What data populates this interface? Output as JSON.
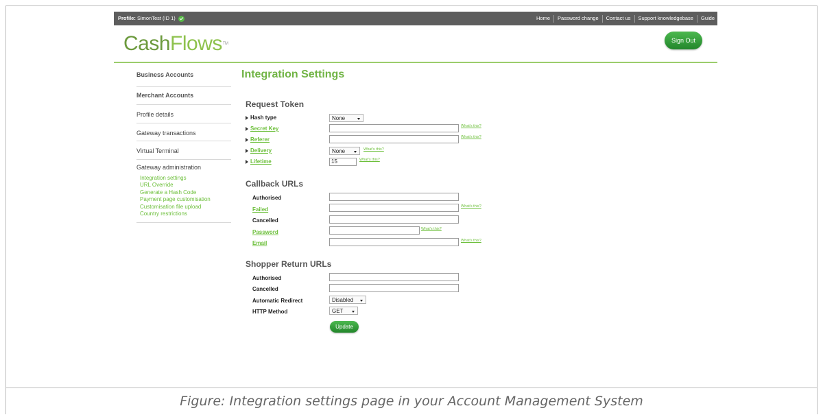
{
  "topbar": {
    "profile_label": "Profile:",
    "profile_value": "SimonTest (ID 1)",
    "nav": [
      "Home",
      "Password change",
      "Contact us",
      "Support knowledgebase",
      "Guide"
    ]
  },
  "logo": {
    "part1": "Cash",
    "part2": "Flows",
    "tm": "TM"
  },
  "signout_label": "Sign Out",
  "sidebar": {
    "items": [
      "Business Accounts",
      "Merchant Accounts",
      "Profile details",
      "Gateway transactions",
      "Virtual Terminal"
    ],
    "admin_header": "Gateway administration",
    "admin_links": [
      "Integration settings",
      "URL Override",
      "Generate a Hash Code",
      "Payment page customisation",
      "Customisation file upload",
      "Country restrictions"
    ]
  },
  "page_title": "Integration Settings",
  "request_token": {
    "title": "Request Token",
    "hash_type": "Hash type",
    "hash_value": "None",
    "secret_key": "Secret Key",
    "referer": "Referer",
    "delivery": "Delivery",
    "delivery_value": "None",
    "lifetime": "Lifetime",
    "lifetime_value": "15"
  },
  "callback": {
    "title": "Callback URLs",
    "authorised": "Authorised",
    "failed": "Failed",
    "cancelled": "Cancelled",
    "password": "Password",
    "email": "Email"
  },
  "shopper": {
    "title": "Shopper Return URLs",
    "authorised": "Authorised",
    "cancelled": "Cancelled",
    "redirect": "Automatic Redirect",
    "redirect_value": "Disabled",
    "http_method": "HTTP Method",
    "http_value": "GET"
  },
  "whats_this": "What's this?",
  "update_label": "Update",
  "caption": "Figure: Integration settings page in your Account Management System"
}
